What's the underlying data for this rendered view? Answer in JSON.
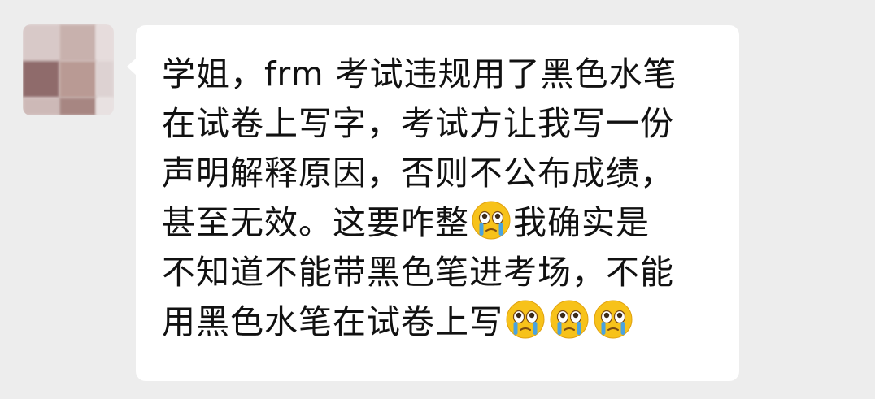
{
  "message": {
    "lines": [
      "学姐，frm 考试违规用了黑色水笔",
      "在试卷上写字，考试方让我写一份",
      "声明解释原因，否则不公布成绩，",
      "甚至无效。这要咋整",
      "我确实是",
      "不知道不能带黑色笔进考场，不能",
      "用黑色水笔在试卷上写"
    ],
    "emoji_name": "crying-face-emoji"
  },
  "colors": {
    "background": "#ededed",
    "bubble": "#ffffff",
    "text": "#111111",
    "emoji_face": "#f7c21a",
    "emoji_tear": "#4aa3e0"
  }
}
